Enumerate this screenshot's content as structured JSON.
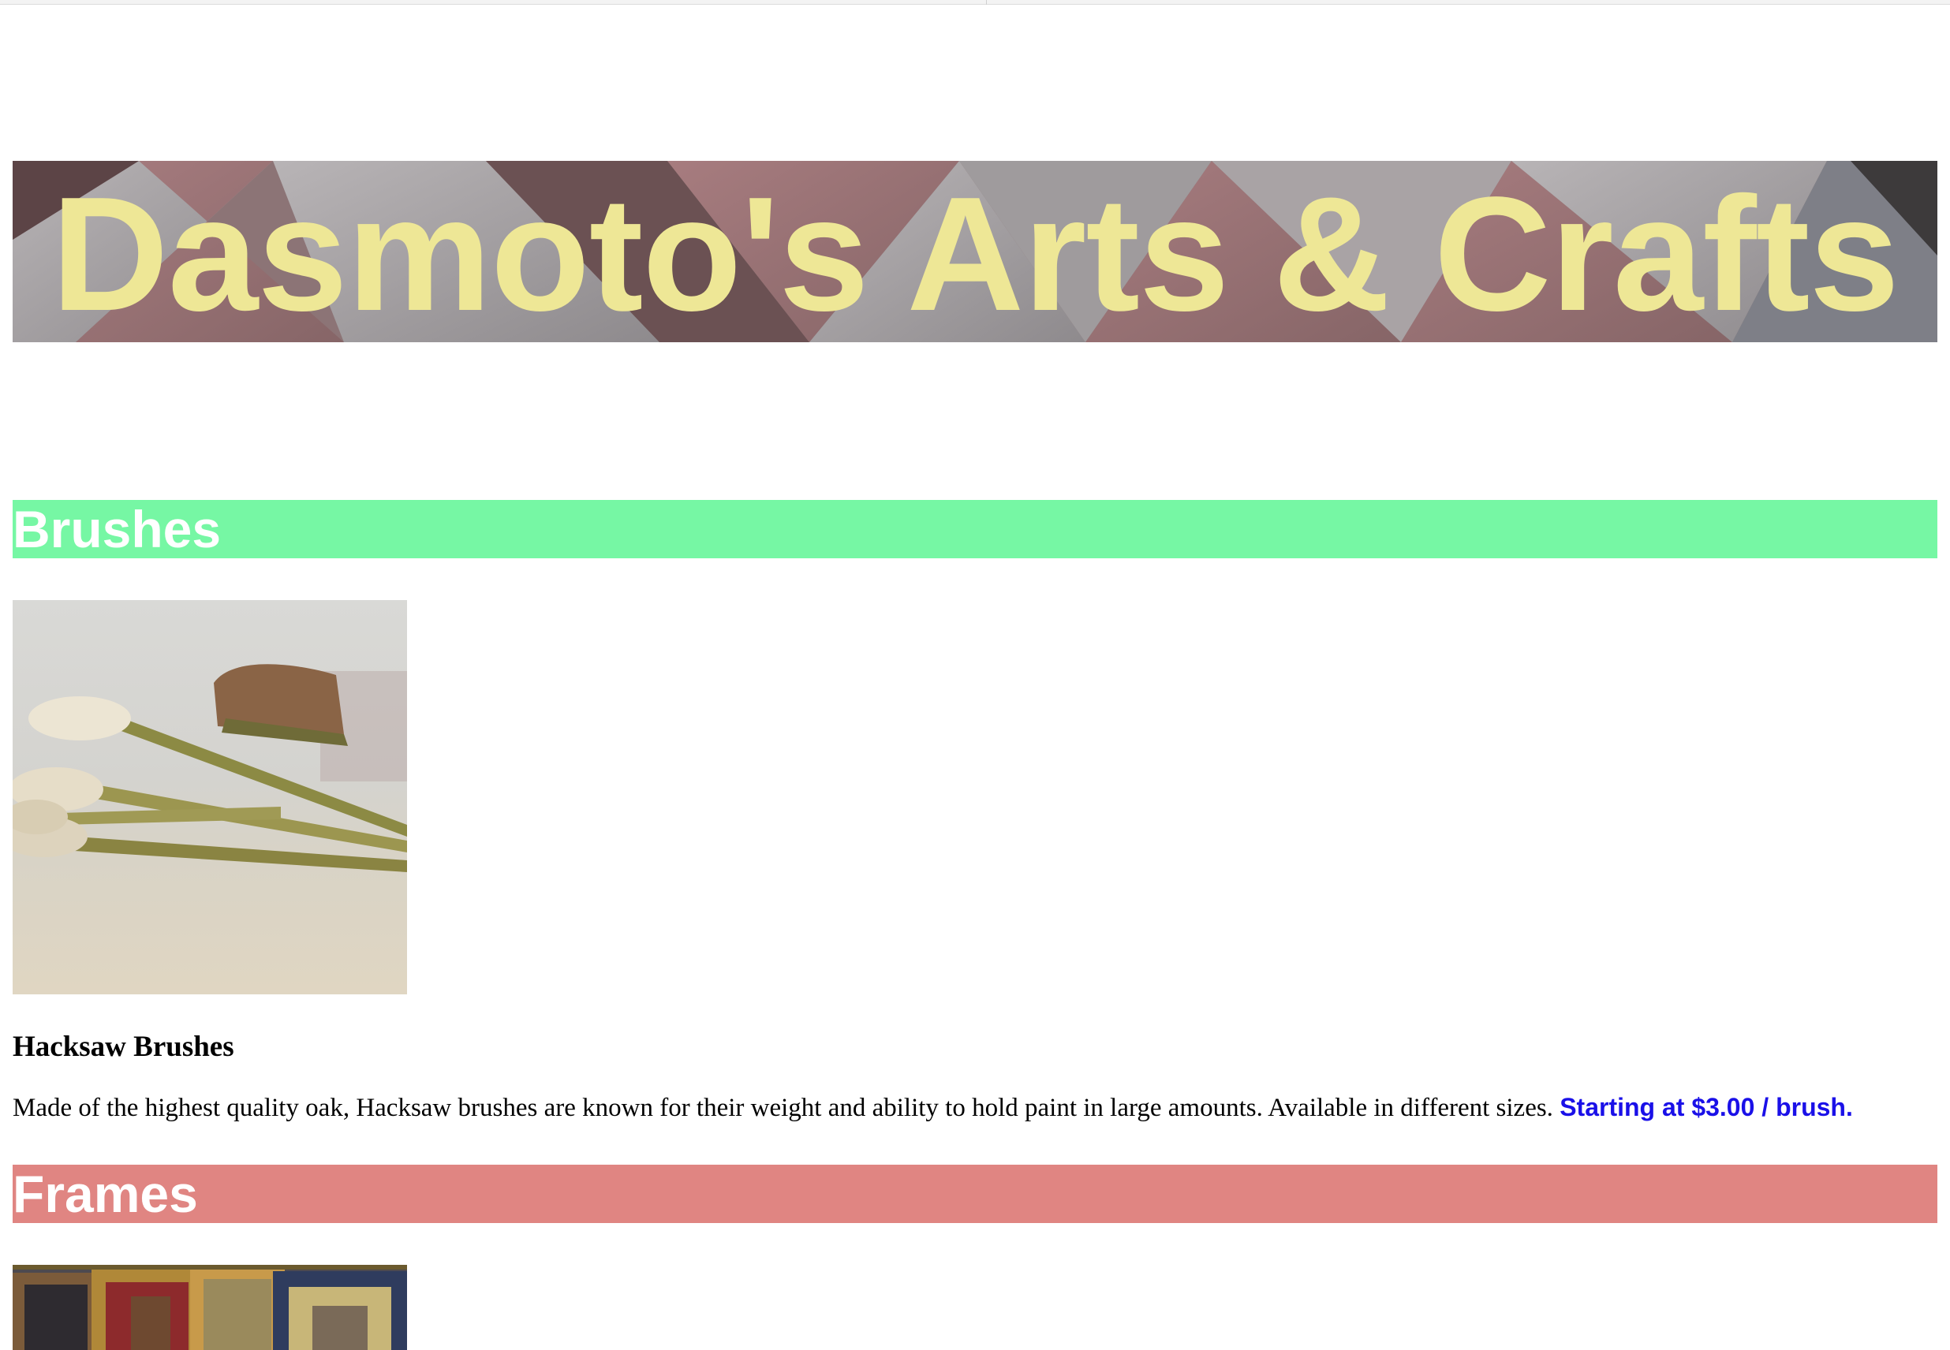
{
  "site": {
    "title": "Dasmoto's Arts & Crafts"
  },
  "colors": {
    "title_text": "#eee796",
    "brushes_header_bg": "#76f7a4",
    "frames_header_bg": "#e08582",
    "price_text": "#1a10e8"
  },
  "sections": {
    "brushes": {
      "heading": "Brushes",
      "product": {
        "image_icon": "paint-brushes-photo",
        "name": "Hacksaw Brushes",
        "description": "Made of the highest quality oak, Hacksaw brushes are known for their weight and ability to hold paint in large amounts. Available in different sizes.",
        "price": "Starting at $3.00 / brush."
      }
    },
    "frames": {
      "heading": "Frames",
      "product": {
        "image_icon": "picture-frames-photo"
      }
    }
  }
}
